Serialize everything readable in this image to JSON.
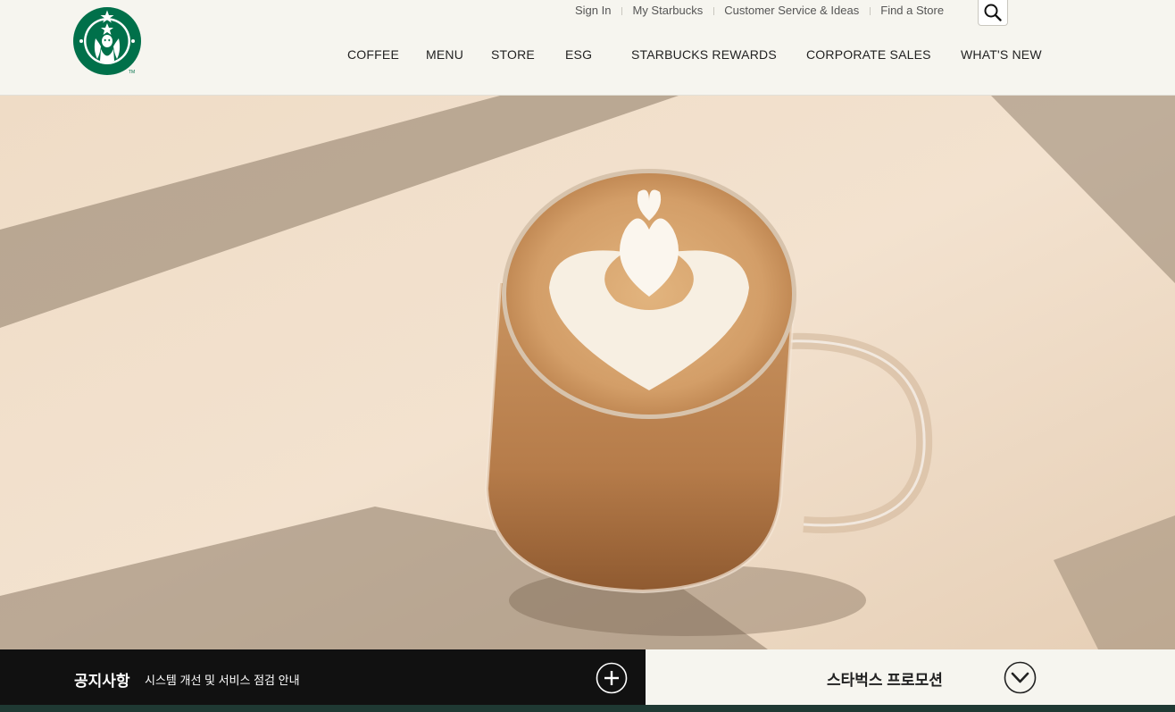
{
  "brand": {
    "name": "Starbucks",
    "logo_icon": "starbucks-siren-logo",
    "colors": {
      "green": "#00704a",
      "dark_green": "#1f3933",
      "notice_bg": "#111111",
      "header_bg": "#f6f5ef"
    }
  },
  "utility_nav": {
    "sign_in": "Sign In",
    "my_starbucks": "My Starbucks",
    "customer_service": "Customer Service & Ideas",
    "find_store": "Find a Store",
    "search_icon": "search-icon"
  },
  "main_nav": {
    "items": [
      {
        "label": "COFFEE"
      },
      {
        "label": "MENU"
      },
      {
        "label": "STORE"
      },
      {
        "label": "ESG"
      },
      {
        "label": "STARBUCKS REWARDS"
      },
      {
        "label": "CORPORATE SALES"
      },
      {
        "label": "WHAT'S NEW"
      }
    ]
  },
  "hero": {
    "image": "latte-art-glass-mug-photo"
  },
  "notice": {
    "title": "공지사항",
    "text": "시스템 개선 및 서비스 점검 안내",
    "more_icon": "plus-circle-icon"
  },
  "promotion": {
    "title": "스타벅스 프로모션",
    "toggle_icon": "chevron-down-circle-icon"
  }
}
